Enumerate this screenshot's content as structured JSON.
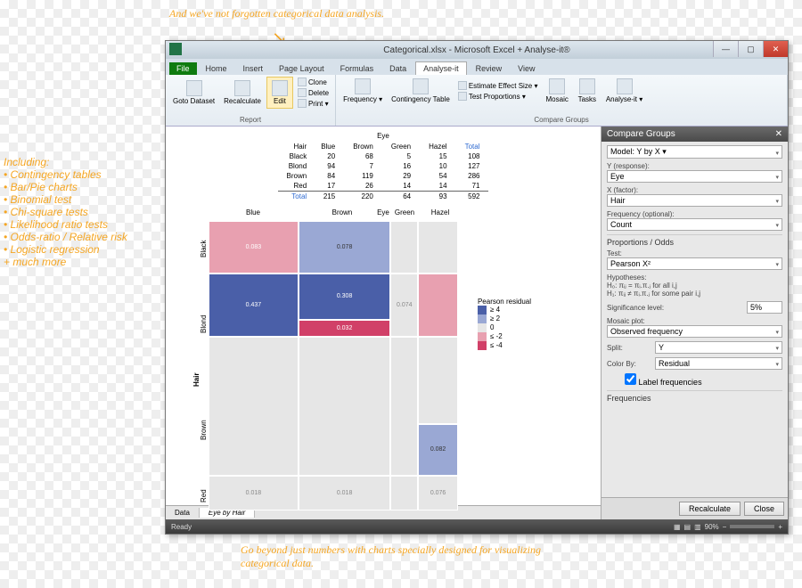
{
  "window": {
    "title": "Categorical.xlsx - Microsoft Excel + Analyse-it®",
    "min": "—",
    "max": "▢",
    "close": "✕"
  },
  "tabs": {
    "file": "File",
    "items": [
      "Home",
      "Insert",
      "Page Layout",
      "Formulas",
      "Data",
      "Analyse-it",
      "Review",
      "View"
    ],
    "active": "Analyse-it"
  },
  "ribbon": {
    "report": {
      "label": "Report",
      "goto": "Goto Dataset",
      "recalc": "Recalculate",
      "edit": "Edit",
      "clone": "Clone",
      "delete": "Delete",
      "print": "Print ▾"
    },
    "compare": {
      "label": "Compare Groups",
      "freq": "Frequency ▾",
      "contingency": "Contingency Table",
      "effect": "Estimate Effect Size ▾",
      "testprop": "Test Proportions ▾",
      "mosaic": "Mosaic",
      "tasks": "Tasks",
      "analyseit": "Analyse-it ▾"
    }
  },
  "chart_data": {
    "type": "table",
    "title": "Eye",
    "row_label": "Hair",
    "columns": [
      "Blue",
      "Brown",
      "Green",
      "Hazel",
      "Total"
    ],
    "rows": [
      {
        "name": "Black",
        "values": [
          20,
          68,
          5,
          15,
          108
        ]
      },
      {
        "name": "Blond",
        "values": [
          94,
          7,
          16,
          10,
          127
        ]
      },
      {
        "name": "Brown",
        "values": [
          84,
          119,
          29,
          54,
          286
        ]
      },
      {
        "name": "Red",
        "values": [
          17,
          26,
          14,
          14,
          71
        ]
      }
    ],
    "totals": {
      "name": "Total",
      "values": [
        215,
        220,
        64,
        93,
        592
      ]
    }
  },
  "mosaic": {
    "title": "Eye",
    "y_axis": "Hair",
    "y_cats": [
      "Black",
      "Blond",
      "Hair",
      "Brown",
      "Red"
    ],
    "x_cats": [
      "Blue",
      "Brown",
      "Green",
      "Hazel"
    ],
    "labels": {
      "t1": "0.083",
      "t2": "0.437",
      "t3": "0.308",
      "t4": "0.032",
      "t5": "0.018",
      "t6": "0.076",
      "t7": "0.078",
      "t8": "0.018",
      "t9": "0.082",
      "t10": "0.074"
    },
    "legend": {
      "title": "Pearson residual",
      "items": [
        "≥ 4",
        "≥ 2",
        "0",
        "≤ -2",
        "≤ -4"
      ]
    }
  },
  "panel": {
    "title": "Compare Groups",
    "model": "Model: Y by X ▾",
    "y_label": "Y (response):",
    "y_value": "Eye",
    "x_label": "X (factor):",
    "x_value": "Hair",
    "freq_label": "Frequency (optional):",
    "freq_value": "Count",
    "section_prop": "Proportions / Odds",
    "test_label": "Test:",
    "test_value": "Pearson X²",
    "hyp_label": "Hypotheses:",
    "hyp_h0": "H₀: πᵢⱼ = πᵢ.π.ⱼ for all i,j",
    "hyp_h1": "H₁: πᵢⱼ ≠ πᵢ.π.ⱼ for some pair i,j",
    "sig_label": "Significance level:",
    "sig_value": "5%",
    "mplot_label": "Mosaic plot:",
    "mplot_value": "Observed frequency",
    "split_label": "Split:",
    "split_value": "Y",
    "color_label": "Color By:",
    "color_value": "Residual",
    "chk_label": "Label frequencies",
    "section_freq": "Frequencies",
    "recalc": "Recalculate",
    "close": "Close"
  },
  "sheets": {
    "data": "Data",
    "active": "Eye by Hair"
  },
  "status": {
    "ready": "Ready",
    "zoom": "90%",
    "minus": "−",
    "plus": "+"
  },
  "annotations": {
    "top": "And we've not forgotten categorical data analysis.",
    "side_title": "Including:",
    "side": [
      "Contingency tables",
      "Bar/Pie charts",
      "Binomial test",
      "Chi-square tests",
      "Likelihood ratio tests",
      "Odds-ratio / Relative risk",
      "Logistic regression"
    ],
    "side_more": "+ much more",
    "bottom": "Go beyond just numbers with charts specially designed for visualizing categorical data."
  },
  "colors": {
    "p4": "#4a5fa8",
    "p2": "#9aa8d4",
    "p0": "#e6e6e6",
    "m2": "#e8a0b0",
    "m4": "#d14068"
  }
}
